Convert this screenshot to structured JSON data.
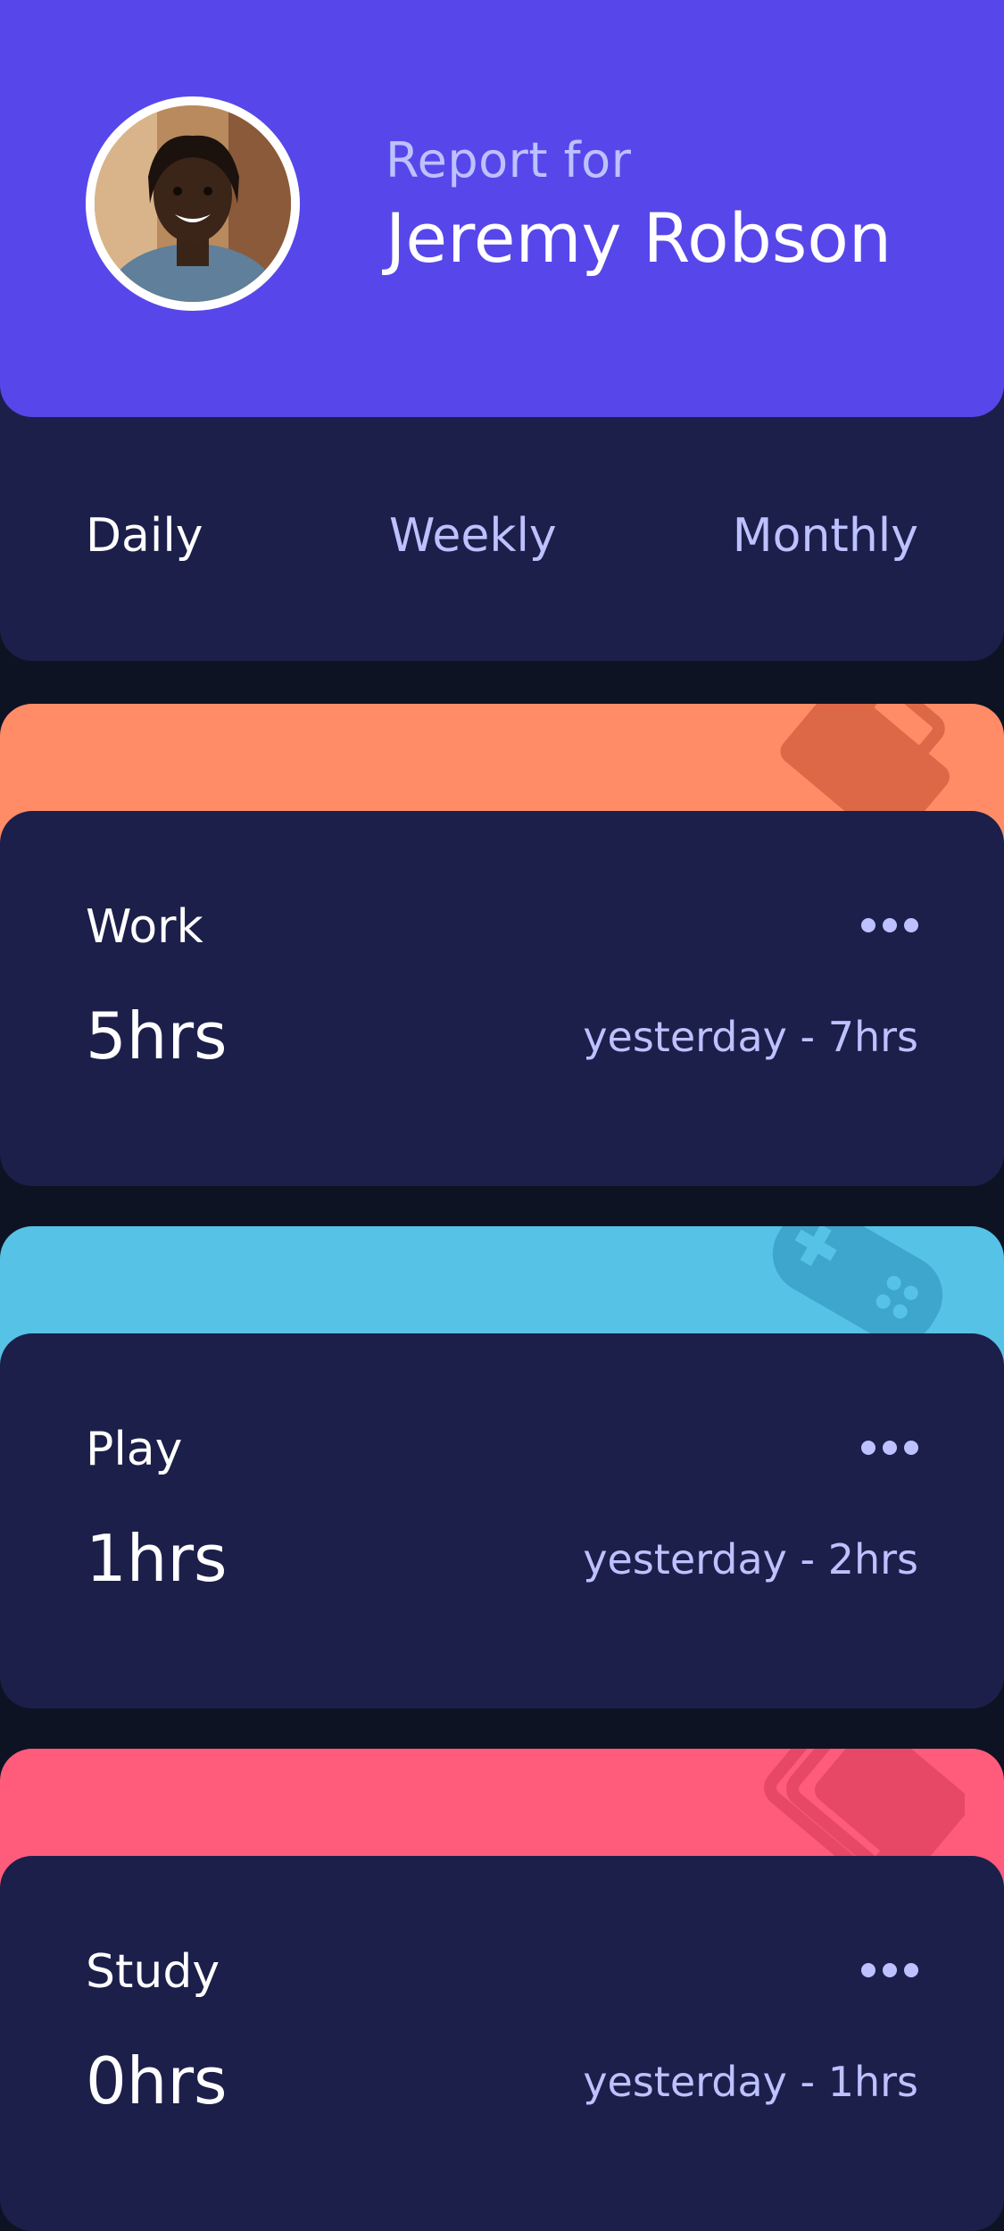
{
  "profile": {
    "report_label": "Report for",
    "name": "Jeremy Robson",
    "header_color": "#5747ea"
  },
  "tabs": [
    {
      "label": "Daily",
      "active": true
    },
    {
      "label": "Weekly",
      "active": false
    },
    {
      "label": "Monthly",
      "active": false
    }
  ],
  "activities": [
    {
      "title": "Work",
      "current": "5hrs",
      "previous": "yesterday - 7hrs",
      "color": "#ff8c66",
      "icon": "briefcase-icon",
      "menu_icon": "ellipsis-icon"
    },
    {
      "title": "Play",
      "current": "1hrs",
      "previous": "yesterday - 2hrs",
      "color": "#56c2e6",
      "icon": "gamepad-icon",
      "menu_icon": "ellipsis-icon"
    },
    {
      "title": "Study",
      "current": "0hrs",
      "previous": "yesterday - 1hrs",
      "color": "#ff5c7c",
      "icon": "book-icon",
      "menu_icon": "ellipsis-icon"
    }
  ]
}
